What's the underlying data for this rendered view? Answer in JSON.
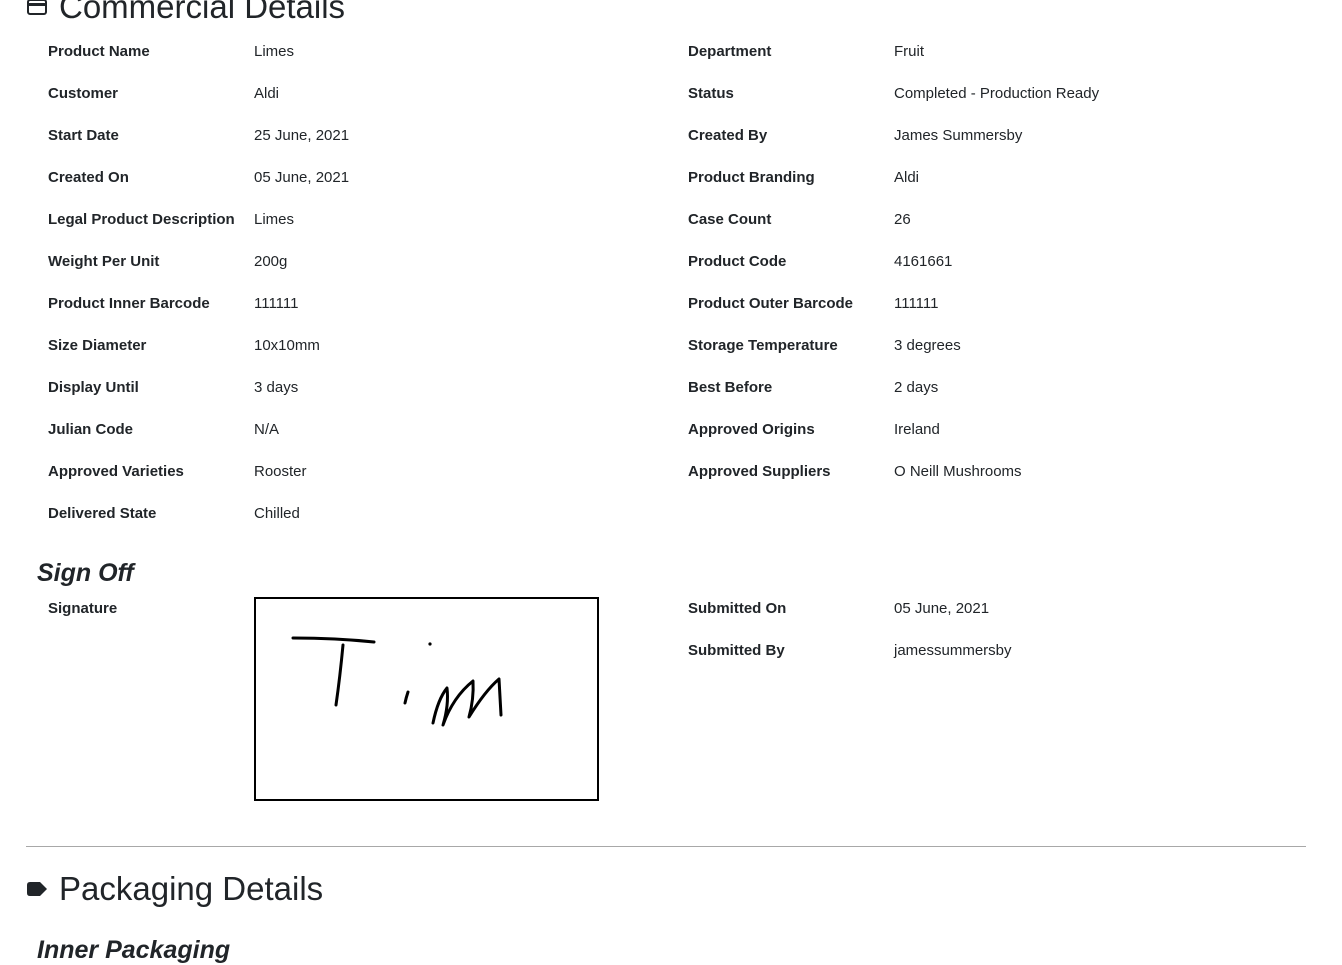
{
  "commercial": {
    "title": "Commercial Details",
    "icon": "card-icon",
    "left": [
      {
        "label": "Product Name",
        "value": "Limes"
      },
      {
        "label": "Customer",
        "value": "Aldi"
      },
      {
        "label": "Start Date",
        "value": "25 June, 2021"
      },
      {
        "label": "Created On",
        "value": "05 June, 2021"
      },
      {
        "label": "Legal Product Description",
        "value": "Limes"
      },
      {
        "label": "Weight Per Unit",
        "value": "200g"
      },
      {
        "label": "Product Inner Barcode",
        "value": "111111"
      },
      {
        "label": "Size Diameter",
        "value": "10x10mm"
      },
      {
        "label": "Display Until",
        "value": "3 days"
      },
      {
        "label": "Julian Code",
        "value": "N/A"
      },
      {
        "label": "Approved Varieties",
        "value": "Rooster"
      },
      {
        "label": "Delivered State",
        "value": "Chilled"
      }
    ],
    "right": [
      {
        "label": "Department",
        "value": "Fruit"
      },
      {
        "label": "Status",
        "value": "Completed - Production Ready"
      },
      {
        "label": "Created By",
        "value": "James Summersby"
      },
      {
        "label": "Product Branding",
        "value": "Aldi"
      },
      {
        "label": "Case Count",
        "value": "26"
      },
      {
        "label": "Product Code",
        "value": "4161661"
      },
      {
        "label": "Product Outer Barcode",
        "value": "111111"
      },
      {
        "label": "Storage Temperature",
        "value": "3 degrees"
      },
      {
        "label": "Best Before",
        "value": "2 days"
      },
      {
        "label": "Approved Origins",
        "value": "Ireland"
      },
      {
        "label": "Approved Suppliers",
        "value": "O Neill Mushrooms"
      }
    ]
  },
  "signoff": {
    "title": "Sign Off",
    "signature_label": "Signature",
    "signature_text": "Tim",
    "submitted_on_label": "Submitted On",
    "submitted_on_value": "05 June, 2021",
    "submitted_by_label": "Submitted By",
    "submitted_by_value": "jamessummersby"
  },
  "packaging": {
    "title": "Packaging Details",
    "icon": "tag-icon",
    "inner_title": "Inner Packaging"
  }
}
